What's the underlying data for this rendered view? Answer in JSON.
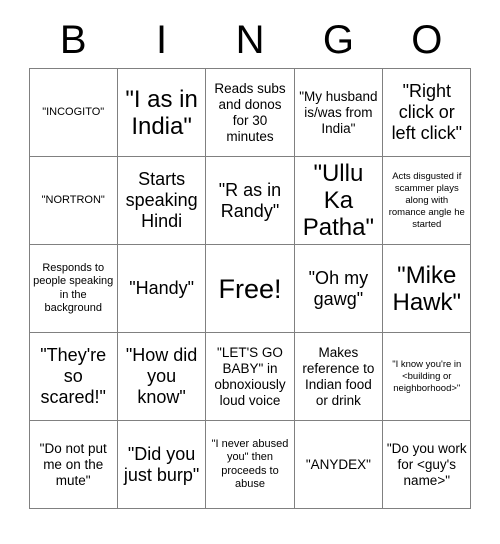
{
  "header": {
    "letters": [
      "B",
      "I",
      "N",
      "G",
      "O"
    ]
  },
  "grid": {
    "rows": [
      [
        {
          "text": "\"INCOGITO\"",
          "size": "t-sm"
        },
        {
          "text": "\"I as in India\"",
          "size": "t-xl"
        },
        {
          "text": "Reads subs and donos for 30 minutes",
          "size": "t-md"
        },
        {
          "text": "\"My husband is/was from India\"",
          "size": "t-md"
        },
        {
          "text": "\"Right click or left click\"",
          "size": "t-lg"
        }
      ],
      [
        {
          "text": "\"NORTRON\"",
          "size": "t-sm"
        },
        {
          "text": "Starts speaking Hindi",
          "size": "t-lg"
        },
        {
          "text": "\"R as in Randy\"",
          "size": "t-lg"
        },
        {
          "text": "\"Ullu Ka Patha\"",
          "size": "t-xl"
        },
        {
          "text": "Acts disgusted if scammer plays along with romance angle he started",
          "size": "t-xs"
        }
      ],
      [
        {
          "text": "Responds to people speaking in the background",
          "size": "t-sm"
        },
        {
          "text": "\"Handy\"",
          "size": "t-lg"
        },
        {
          "text": "Free!",
          "size": "t-free"
        },
        {
          "text": "\"Oh my gawg\"",
          "size": "t-lg"
        },
        {
          "text": "\"Mike Hawk\"",
          "size": "t-xl"
        }
      ],
      [
        {
          "text": "\"They're so scared!\"",
          "size": "t-lg"
        },
        {
          "text": "\"How did you know\"",
          "size": "t-lg"
        },
        {
          "text": "\"LET'S GO BABY\" in obnoxiously loud voice",
          "size": "t-md"
        },
        {
          "text": "Makes reference to Indian food or drink",
          "size": "t-md"
        },
        {
          "text": "\"I know you're in <building or neighborhood>\"",
          "size": "t-xs"
        }
      ],
      [
        {
          "text": "\"Do not put me on the mute\"",
          "size": "t-md"
        },
        {
          "text": "\"Did you just burp\"",
          "size": "t-lg"
        },
        {
          "text": "\"I never abused you\" then proceeds to abuse",
          "size": "t-sm"
        },
        {
          "text": "\"ANYDEX\"",
          "size": "t-md"
        },
        {
          "text": "\"Do you work for <guy's name>\"",
          "size": "t-md"
        }
      ]
    ]
  }
}
